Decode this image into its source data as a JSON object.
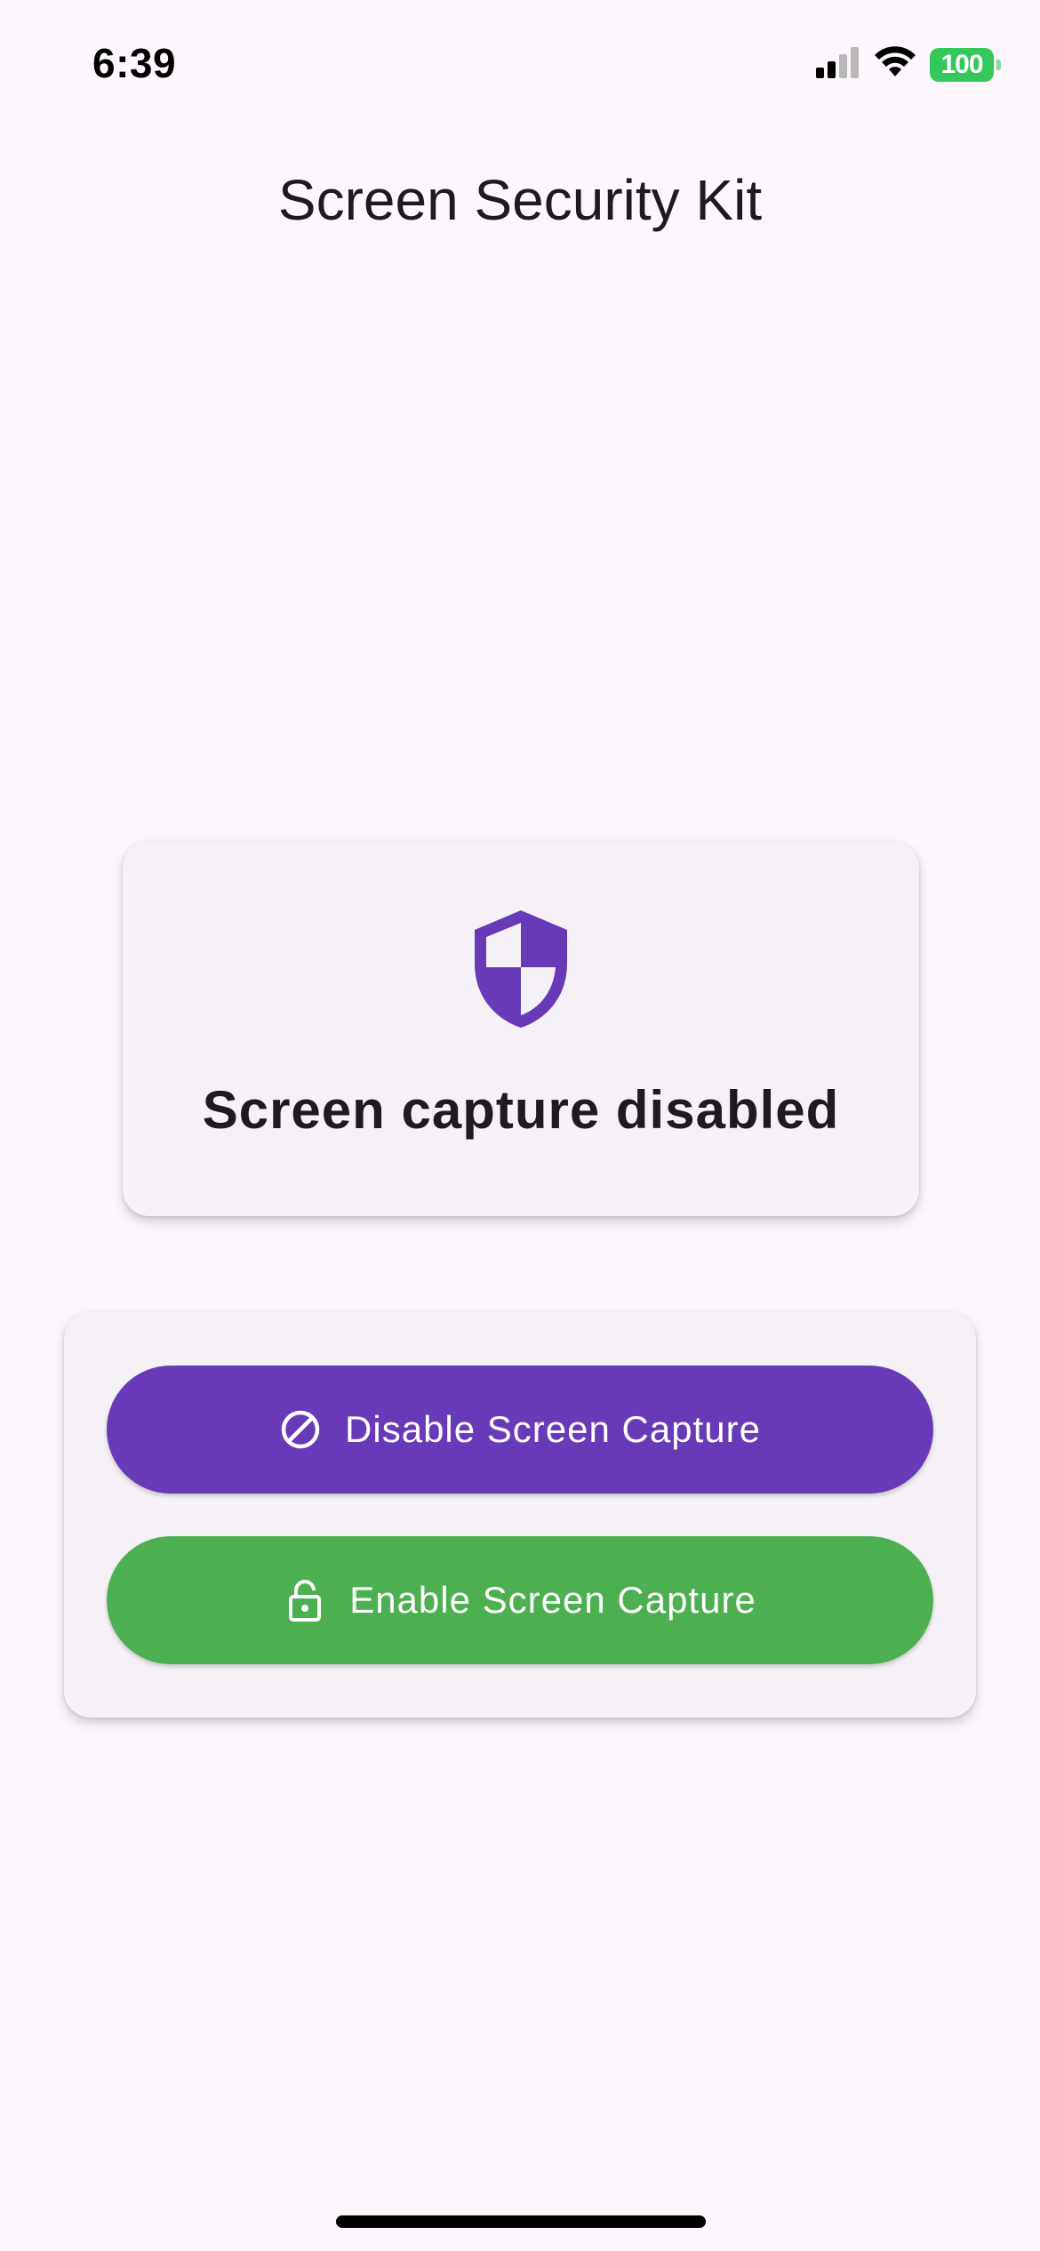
{
  "status_bar": {
    "time": "6:39",
    "battery": "100",
    "icons": [
      "cellular-signal-icon",
      "wifi-icon",
      "battery-icon"
    ]
  },
  "app_bar": {
    "title": "Screen Security Kit"
  },
  "status_card": {
    "icon": "shield-icon",
    "text": "Screen capture disabled"
  },
  "actions": {
    "disable_button": {
      "label": "Disable Screen Capture",
      "icon": "block-icon"
    },
    "enable_button": {
      "label": "Enable Screen Capture",
      "icon": "lock-open-icon"
    }
  },
  "colors": {
    "background": "#fdf7fd",
    "card": "#f5f1f7",
    "primary_purple": "#673ab7",
    "success_green": "#4caf50",
    "battery_green": "#34c759"
  }
}
